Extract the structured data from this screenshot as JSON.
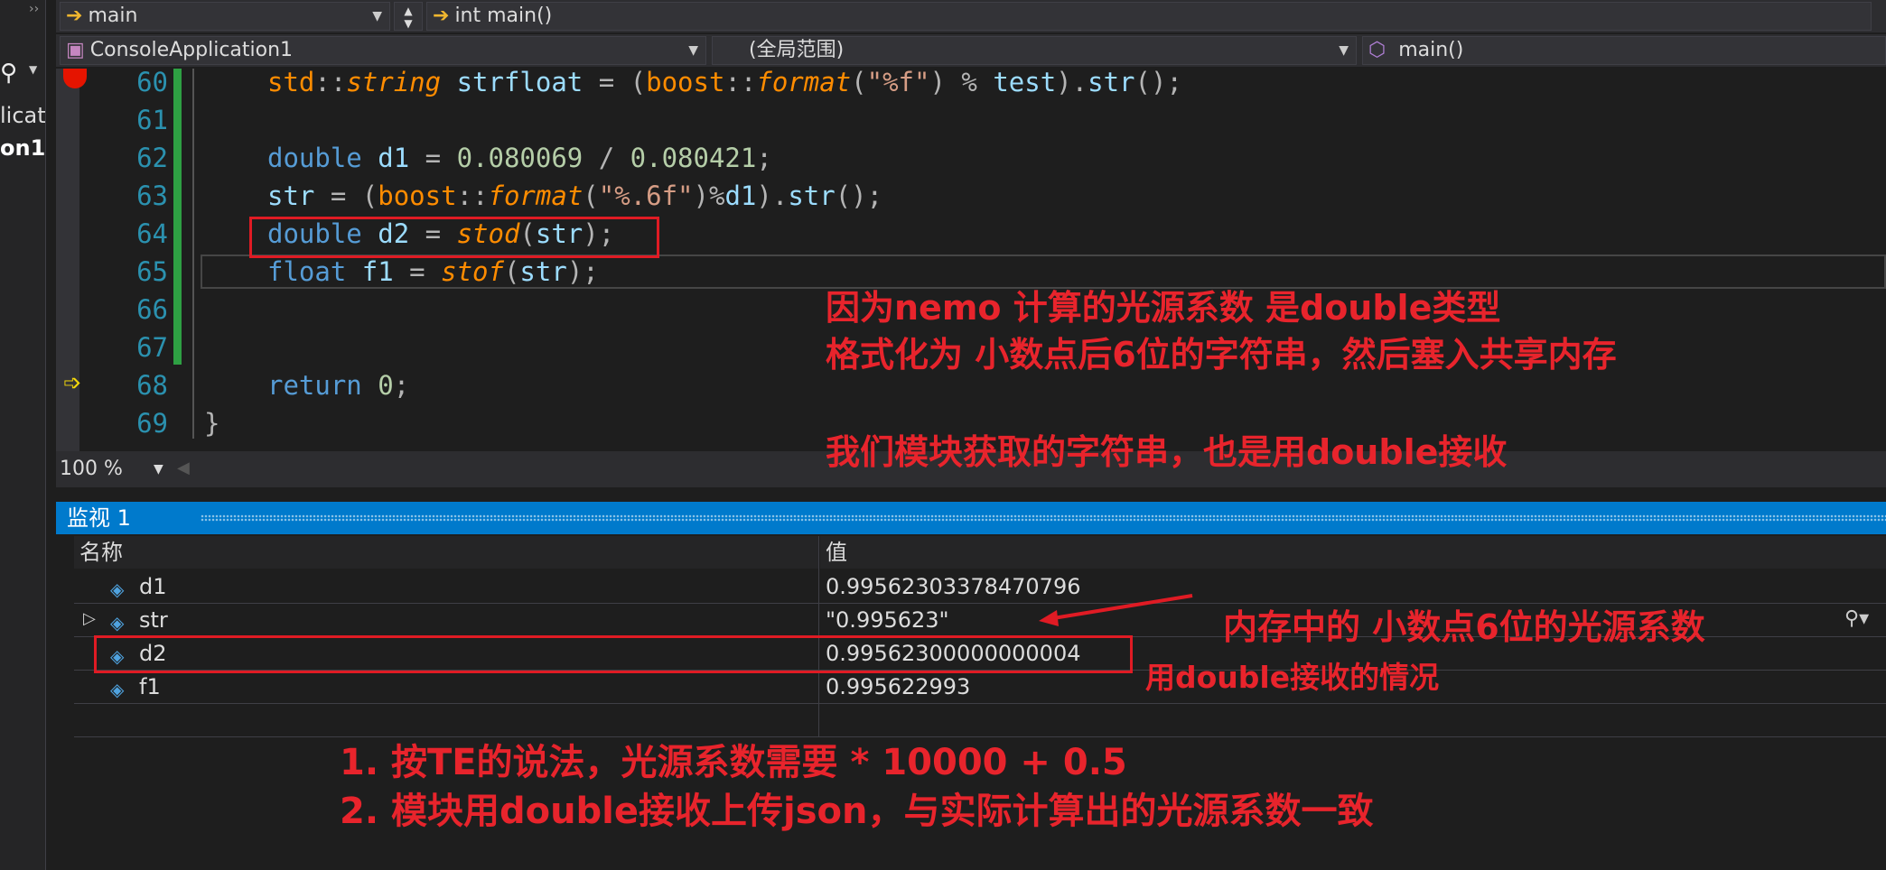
{
  "nav": {
    "combo1": "main",
    "combo2": "int main()",
    "project": "ConsoleApplication1",
    "scope": "(全局范围)",
    "member": "main()"
  },
  "left_panel": {
    "line1": "licati",
    "line2": "on1"
  },
  "code": [
    {
      "num": "60",
      "text": "std::string strfloat = (boost::format(\"%f\") % test).str();"
    },
    {
      "num": "61",
      "text": ""
    },
    {
      "num": "62",
      "text": "double d1 = 0.080069 / 0.080421;"
    },
    {
      "num": "63",
      "text": "str = (boost::format(\"%.6f\")%d1).str();"
    },
    {
      "num": "64",
      "text": "double d2 = stod(str);"
    },
    {
      "num": "65",
      "text": "float f1 = stof(str);"
    },
    {
      "num": "66",
      "text": ""
    },
    {
      "num": "67",
      "text": ""
    },
    {
      "num": "68",
      "text": "return 0;"
    },
    {
      "num": "69",
      "text": "}"
    }
  ],
  "zoom": "100 %",
  "watch": {
    "title": "监视 1",
    "col_name": "名称",
    "col_value": "值",
    "rows": [
      {
        "name": "d1",
        "value": "0.99562303378470796"
      },
      {
        "name": "str",
        "value": "\"0.995623\""
      },
      {
        "name": "d2",
        "value": "0.99562300000000004"
      },
      {
        "name": "f1",
        "value": "0.995622993"
      }
    ]
  },
  "annotations": {
    "a1": "因为nemo 计算的光源系数 是double类型",
    "a2": "格式化为 小数点后6位的字符串，然后塞入共享内存",
    "a3": "我们模块获取的字符串，也是用double接收",
    "a4": "内存中的 小数点6位的光源系数",
    "a5": "用double接收的情况",
    "a6": "1. 按TE的说法，光源系数需要 * 10000 + 0.5",
    "a7": "2. 模块用double接收上传json，与实际计算出的光源系数一致"
  },
  "colors": {
    "accent": "#007acc",
    "annotation": "#e8242c",
    "breakpoint": "#e51400",
    "green_changes": "#2ea043"
  }
}
